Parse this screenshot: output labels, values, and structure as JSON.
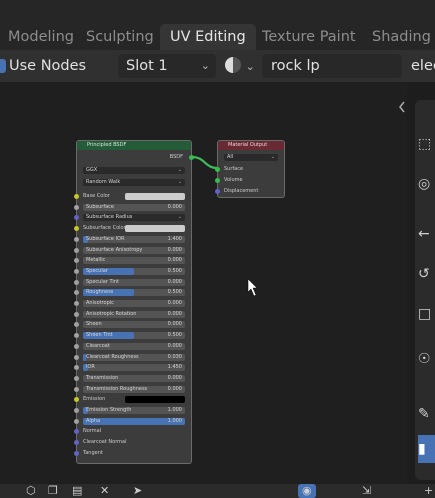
{
  "workspace_tabs": [
    {
      "label": "Modeling",
      "active": false
    },
    {
      "label": "Sculpting",
      "active": false
    },
    {
      "label": "UV Editing",
      "active": true
    },
    {
      "label": "Texture Paint",
      "active": false
    },
    {
      "label": "Shading",
      "active": false
    }
  ],
  "header": {
    "use_nodes_label": "Use Nodes",
    "slot_label": "Slot 1",
    "material_name": "rock lp",
    "cut_label": "elec"
  },
  "bsdf_node": {
    "title": "Principled BSDF",
    "output_label": "BSDF",
    "distribution": "GGX",
    "subsurface_method": "Random Walk",
    "rows": [
      {
        "label": "Base Color",
        "kind": "color",
        "socket": "y"
      },
      {
        "label": "Subsurface",
        "kind": "value",
        "value": "0.000",
        "socket": "g",
        "fill": 0
      },
      {
        "label": "Subsurface Radius",
        "kind": "dropdown",
        "socket": "b"
      },
      {
        "label": "Subsurface Color",
        "kind": "color",
        "socket": "y"
      },
      {
        "label": "Subsurface IOR",
        "kind": "value",
        "value": "1.400",
        "socket": "g",
        "fill": 0.05
      },
      {
        "label": "Subsurface Anisotropy",
        "kind": "value",
        "value": "0.000",
        "socket": "g",
        "fill": 0
      },
      {
        "label": "Metallic",
        "kind": "value",
        "value": "0.000",
        "socket": "g",
        "fill": 0
      },
      {
        "label": "Specular",
        "kind": "value",
        "value": "0.500",
        "socket": "g",
        "fill": 0.5
      },
      {
        "label": "Specular Tint",
        "kind": "value",
        "value": "0.000",
        "socket": "g",
        "fill": 0
      },
      {
        "label": "Roughness",
        "kind": "value",
        "value": "0.500",
        "socket": "g",
        "fill": 0.5
      },
      {
        "label": "Anisotropic",
        "kind": "value",
        "value": "0.000",
        "socket": "g",
        "fill": 0
      },
      {
        "label": "Anisotropic Rotation",
        "kind": "value",
        "value": "0.000",
        "socket": "g",
        "fill": 0
      },
      {
        "label": "Sheen",
        "kind": "value",
        "value": "0.000",
        "socket": "g",
        "fill": 0
      },
      {
        "label": "Sheen Tint",
        "kind": "value",
        "value": "0.500",
        "socket": "g",
        "fill": 0.5
      },
      {
        "label": "Clearcoat",
        "kind": "value",
        "value": "0.000",
        "socket": "g",
        "fill": 0
      },
      {
        "label": "Clearcoat Roughness",
        "kind": "value",
        "value": "0.030",
        "socket": "g",
        "fill": 0.03
      },
      {
        "label": "IOR",
        "kind": "value",
        "value": "1.450",
        "socket": "g",
        "fill": 0.05
      },
      {
        "label": "Transmission",
        "kind": "value",
        "value": "0.000",
        "socket": "g",
        "fill": 0
      },
      {
        "label": "Transmission Roughness",
        "kind": "value",
        "value": "0.000",
        "socket": "g",
        "fill": 0
      },
      {
        "label": "Emission",
        "kind": "color-dark",
        "socket": "y"
      },
      {
        "label": "Emission Strength",
        "kind": "value",
        "value": "1.000",
        "socket": "g",
        "fill": 0.05
      },
      {
        "label": "Alpha",
        "kind": "value",
        "value": "1.000",
        "socket": "g",
        "fill": 1.0
      },
      {
        "label": "Normal",
        "kind": "label",
        "socket": "b"
      },
      {
        "label": "Clearcoat Normal",
        "kind": "label",
        "socket": "b"
      },
      {
        "label": "Tangent",
        "kind": "label",
        "socket": "b"
      }
    ]
  },
  "output_node": {
    "title": "Material Output",
    "target": "All",
    "inputs": [
      "Surface",
      "Volume",
      "Displacement"
    ]
  },
  "colors": {
    "accent": "#4772b3",
    "bsdf_header": "#245c39",
    "output_header": "#6a2a34"
  }
}
